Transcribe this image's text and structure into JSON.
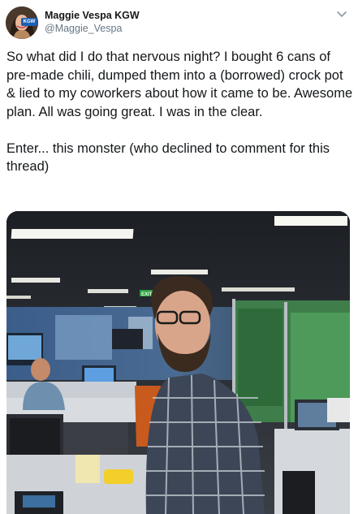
{
  "author": {
    "display_name": "Maggie Vespa KGW",
    "handle": "@Maggie_Vespa",
    "avatar_badge": "KGW",
    "avatar_icon": "profile-photo"
  },
  "menu_icon": "chevron-down-icon",
  "tweet": {
    "text": "So what did I do that nervous night? I bought 6 cans of pre-made chili, dumped them into a (borrowed) crock pot & lied to my coworkers about how it came to be. Awesome plan. All was going great. I was in the clear.\n\nEnter... this monster (who declined to comment for this thread)"
  },
  "media": {
    "type": "photo",
    "exit_sign": "EXIT"
  },
  "colors": {
    "text": "#14171a",
    "secondary": "#657786",
    "brand_badge": "#1d5fb4"
  }
}
